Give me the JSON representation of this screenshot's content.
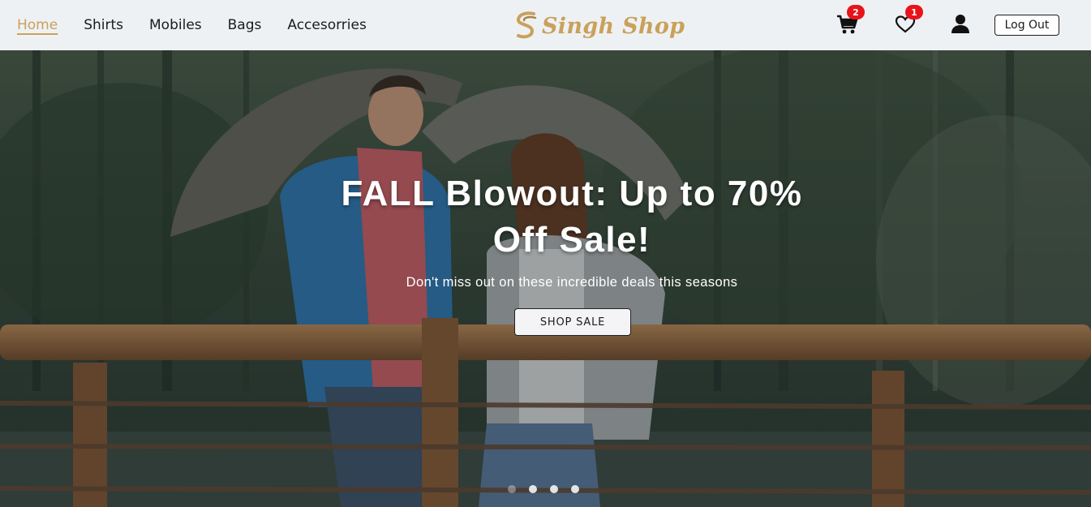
{
  "nav": {
    "links": [
      {
        "label": "Home",
        "active": true
      },
      {
        "label": "Shirts",
        "active": false
      },
      {
        "label": "Mobiles",
        "active": false
      },
      {
        "label": "Bags",
        "active": false
      },
      {
        "label": "Accesorries",
        "active": false
      }
    ],
    "brand": "Singh Shop",
    "cart_count": "2",
    "wishlist_count": "1",
    "logout_label": "Log Out",
    "accent_color": "#c9a15a",
    "badge_color": "#e8141a"
  },
  "hero": {
    "title": "FALL Blowout: Up to 70% Off Sale!",
    "subtitle": "Don't miss out on these incredible deals this seasons",
    "cta_label": "SHOP SALE",
    "slide_count": 4,
    "active_slide": 1
  },
  "icons": {
    "cart": "cart-icon",
    "wishlist": "heart-icon",
    "account": "user-icon"
  }
}
